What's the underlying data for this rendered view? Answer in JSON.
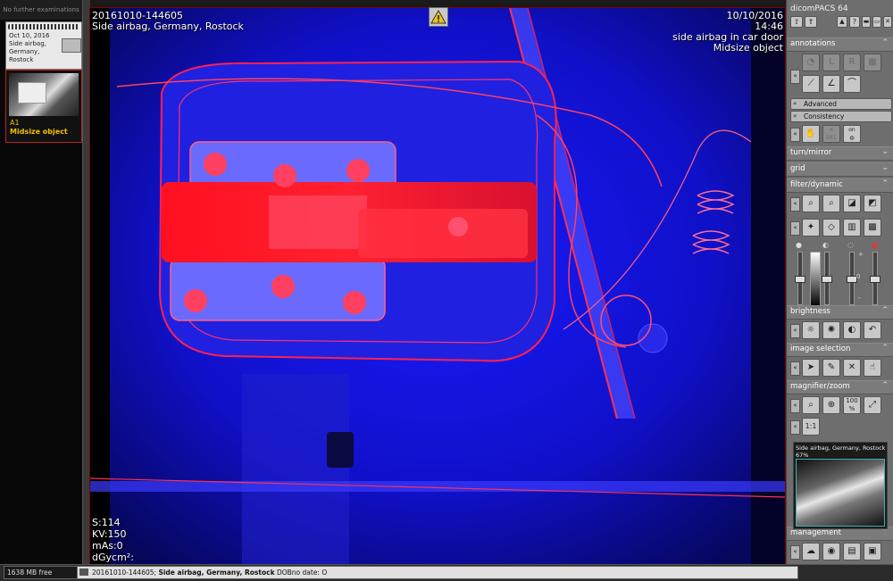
{
  "left_panel": {
    "header": "No further examinations",
    "study": {
      "date": "Oct 10, 2016",
      "line2": "Side airbag,",
      "line3": "Germany,",
      "line4": "Rostock"
    },
    "series": {
      "label": "A1",
      "name": "Midsize object"
    }
  },
  "viewer": {
    "top_left_1": "20161010-144605",
    "top_left_2": "Side airbag, Germany, Rostock",
    "top_right_1": "10/10/2016",
    "top_right_2": "14:46",
    "top_right_3": "side airbag in car door",
    "top_right_4": "Midsize object",
    "bottom_left": [
      "S:114",
      "KV:150",
      "mAs:0",
      "dGycm²:"
    ]
  },
  "right_panel": {
    "app_title": "dicomPACS 64",
    "sections": {
      "annotations": "annotations",
      "advanced": "Advanced",
      "consistency": "Consistency",
      "turn_mirror": "turn/mirror",
      "grid": "grid",
      "filter_dynamic": "filter/dynamic",
      "brightness": "brightness",
      "image_selection": "image selection",
      "magnifier_zoom": "magnifier/zoom",
      "management": "management"
    },
    "buttons": {
      "del": "DEL",
      "on": "on",
      "zoom100": "100",
      "zoom100_unit": "%",
      "one_to_one": "1:1"
    },
    "slider_values": {
      "mid_label": "0",
      "plus": "+",
      "minus": "-"
    },
    "preview": {
      "caption": "Side airbag, Germany, Rostock",
      "percent": "67%"
    }
  },
  "status_bar": {
    "free_space": "1638 MB free",
    "study_id": "20161010-144605",
    "separator": ";",
    "study_desc": "Side airbag, Germany, Rostock",
    "dob": "DOBno date: O"
  }
}
